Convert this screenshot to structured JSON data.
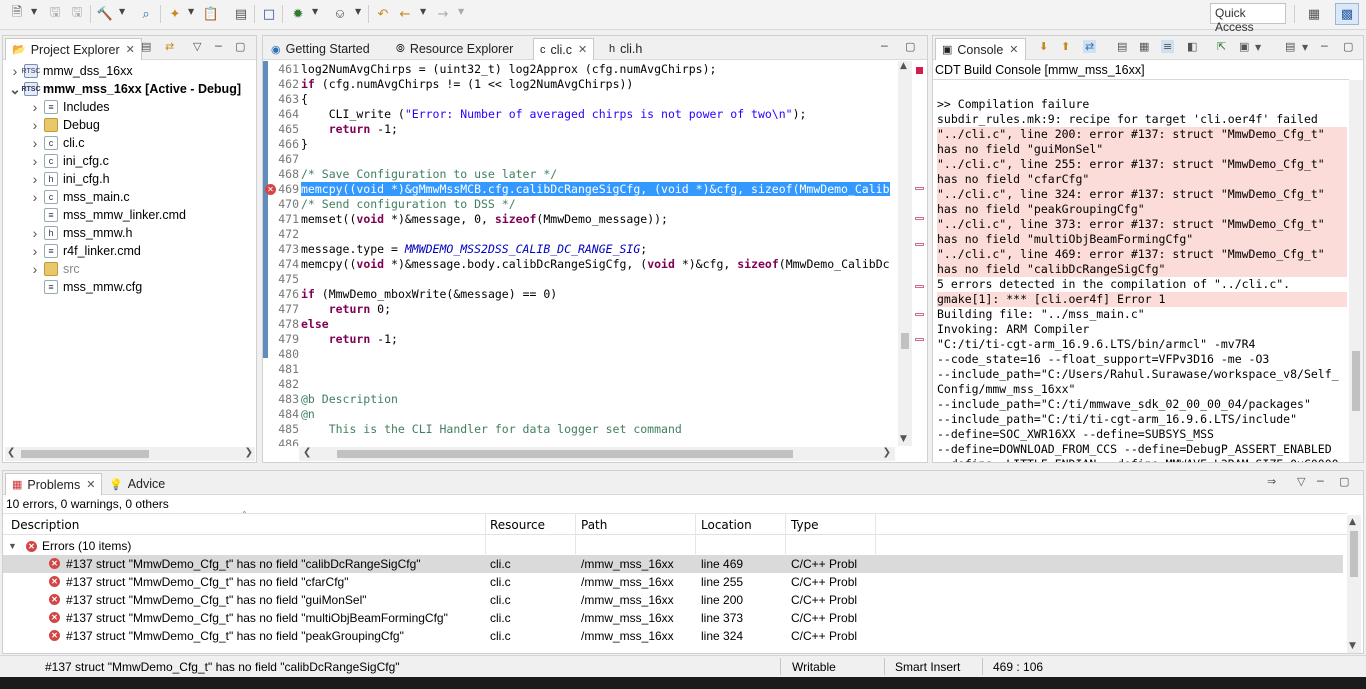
{
  "toolbar": {
    "quick_access": "Quick Access"
  },
  "project_explorer": {
    "tab_label": "Project Explorer",
    "items": [
      {
        "label": "mmw_dss_16xx",
        "icon": "project-icon"
      },
      {
        "label": "mmw_mss_16xx  [Active - Debug]",
        "icon": "project-icon"
      },
      {
        "label": "Includes",
        "icon": "includes-icon"
      },
      {
        "label": "Debug",
        "icon": "folder-icon"
      },
      {
        "label": "cli.c",
        "icon": "c-file-icon"
      },
      {
        "label": "ini_cfg.c",
        "icon": "c-file-icon"
      },
      {
        "label": "ini_cfg.h",
        "icon": "h-file-icon"
      },
      {
        "label": "mss_main.c",
        "icon": "c-file-icon"
      },
      {
        "label": "mss_mmw_linker.cmd",
        "icon": "file-icon"
      },
      {
        "label": "mss_mmw.h",
        "icon": "h-file-icon"
      },
      {
        "label": "r4f_linker.cmd",
        "icon": "file-icon"
      },
      {
        "label": "src",
        "icon": "folder-icon"
      },
      {
        "label": "mss_mmw.cfg",
        "icon": "file-icon"
      }
    ]
  },
  "editor": {
    "tabs": [
      {
        "label": "Getting Started"
      },
      {
        "label": "Resource Explorer"
      },
      {
        "label": "cli.c"
      },
      {
        "label": "cli.h"
      }
    ],
    "lines": [
      {
        "num": "461",
        "text": "log2NumAvgChirps = (uint32_t) log2Approx (cfg.numAvgChirps);"
      },
      {
        "num": "462",
        "text": "if (cfg.numAvgChirps != (1 << log2NumAvgChirps))"
      },
      {
        "num": "463",
        "text": "{"
      },
      {
        "num": "464",
        "text": "    CLI_write (\"Error: Number of averaged chirps is not power of two\\n\");"
      },
      {
        "num": "465",
        "text": "    return -1;"
      },
      {
        "num": "466",
        "text": "}"
      },
      {
        "num": "467",
        "text": ""
      },
      {
        "num": "468",
        "text": "/* Save Configuration to use later */"
      },
      {
        "num": "469",
        "text": "memcpy((void *)&gMmwMssMCB.cfg.calibDcRangeSigCfg, (void *)&cfg, sizeof(MmwDemo_Calib"
      },
      {
        "num": "470",
        "text": "/* Send configuration to DSS */"
      },
      {
        "num": "471",
        "text": "memset((void *)&message, 0, sizeof(MmwDemo_message));"
      },
      {
        "num": "472",
        "text": ""
      },
      {
        "num": "473",
        "text": "message.type = MMWDEMO_MSS2DSS_CALIB_DC_RANGE_SIG;"
      },
      {
        "num": "474",
        "text": "memcpy((void *)&message.body.calibDcRangeSigCfg, (void *)&cfg, sizeof(MmwDemo_CalibDc"
      },
      {
        "num": "475",
        "text": ""
      },
      {
        "num": "476",
        "text": "if (MmwDemo_mboxWrite(&message) == 0)"
      },
      {
        "num": "477",
        "text": "    return 0;"
      },
      {
        "num": "478",
        "text": "else"
      },
      {
        "num": "479",
        "text": "    return -1;"
      },
      {
        "num": "480",
        "text": ""
      },
      {
        "num": "481",
        "text": ""
      },
      {
        "num": "482",
        "text": ""
      },
      {
        "num": "483",
        "text": "@b Description"
      },
      {
        "num": "484",
        "text": "@n"
      },
      {
        "num": "485",
        "text": "    This is the CLI Handler for data logger set command"
      },
      {
        "num": "486",
        "text": ""
      }
    ]
  },
  "console": {
    "tab_label": "Console",
    "title": "CDT Build Console [mmw_mss_16xx]",
    "lines": [
      {
        "text": "",
        "err": false
      },
      {
        "text": ">> Compilation failure",
        "err": false
      },
      {
        "text": "subdir_rules.mk:9: recipe for target 'cli.oer4f' failed",
        "err": false
      },
      {
        "text": "\"../cli.c\", line 200: error #137: struct \"MmwDemo_Cfg_t\"",
        "err": true
      },
      {
        "text": "has no field \"guiMonSel\"",
        "err": true
      },
      {
        "text": "\"../cli.c\", line 255: error #137: struct \"MmwDemo_Cfg_t\"",
        "err": true
      },
      {
        "text": "has no field \"cfarCfg\"",
        "err": true
      },
      {
        "text": "\"../cli.c\", line 324: error #137: struct \"MmwDemo_Cfg_t\"",
        "err": true
      },
      {
        "text": "has no field \"peakGroupingCfg\"",
        "err": true
      },
      {
        "text": "\"../cli.c\", line 373: error #137: struct \"MmwDemo_Cfg_t\"",
        "err": true
      },
      {
        "text": "has no field \"multiObjBeamFormingCfg\"",
        "err": true
      },
      {
        "text": "\"../cli.c\", line 469: error #137: struct \"MmwDemo_Cfg_t\"",
        "err": true
      },
      {
        "text": "has no field \"calibDcRangeSigCfg\"",
        "err": true
      },
      {
        "text": "5 errors detected in the compilation of \"../cli.c\".",
        "err": false
      },
      {
        "text": "gmake[1]: *** [cli.oer4f] Error 1",
        "err": true
      },
      {
        "text": "Building file: \"../mss_main.c\"",
        "err": false
      },
      {
        "text": "Invoking: ARM Compiler",
        "err": false
      },
      {
        "text": "\"C:/ti/ti-cgt-arm_16.9.6.LTS/bin/armcl\" -mv7R4",
        "err": false
      },
      {
        "text": "--code_state=16 --float_support=VFPv3D16 -me -O3",
        "err": false
      },
      {
        "text": "--include_path=\"C:/Users/Rahul.Surawase/workspace_v8/Self_",
        "err": false
      },
      {
        "text": "Config/mmw_mss_16xx\"",
        "err": false
      },
      {
        "text": "--include_path=\"C:/ti/mmwave_sdk_02_00_00_04/packages\"",
        "err": false
      },
      {
        "text": "--include_path=\"C:/ti/ti-cgt-arm_16.9.6.LTS/include\"",
        "err": false
      },
      {
        "text": "--define=SOC_XWR16XX --define=SUBSYS_MSS",
        "err": false
      },
      {
        "text": "--define=DOWNLOAD_FROM_CCS --define=DebugP_ASSERT_ENABLED",
        "err": false
      },
      {
        "text": "--define=_LITTLE_ENDIAN --define=MMWAVE_L3RAM_SIZE=0xC0000",
        "err": false
      }
    ]
  },
  "problems": {
    "tabs": [
      {
        "label": "Problems"
      },
      {
        "label": "Advice"
      }
    ],
    "summary": "10 errors, 0 warnings, 0 others",
    "columns": [
      "Description",
      "Resource",
      "Path",
      "Location",
      "Type"
    ],
    "group_label": "Errors (10 items)",
    "rows": [
      {
        "description": "#137 struct \"MmwDemo_Cfg_t\" has no field \"calibDcRangeSigCfg\"",
        "resource": "cli.c",
        "path": "/mmw_mss_16xx",
        "location": "line 469",
        "type": "C/C++ Probl"
      },
      {
        "description": "#137 struct \"MmwDemo_Cfg_t\" has no field \"cfarCfg\"",
        "resource": "cli.c",
        "path": "/mmw_mss_16xx",
        "location": "line 255",
        "type": "C/C++ Probl"
      },
      {
        "description": "#137 struct \"MmwDemo_Cfg_t\" has no field \"guiMonSel\"",
        "resource": "cli.c",
        "path": "/mmw_mss_16xx",
        "location": "line 200",
        "type": "C/C++ Probl"
      },
      {
        "description": "#137 struct \"MmwDemo_Cfg_t\" has no field \"multiObjBeamFormingCfg\"",
        "resource": "cli.c",
        "path": "/mmw_mss_16xx",
        "location": "line 373",
        "type": "C/C++ Probl"
      },
      {
        "description": "#137 struct \"MmwDemo_Cfg_t\" has no field \"peakGroupingCfg\"",
        "resource": "cli.c",
        "path": "/mmw_mss_16xx",
        "location": "line 324",
        "type": "C/C++ Probl"
      }
    ]
  },
  "statusbar": {
    "message": "#137 struct \"MmwDemo_Cfg_t\" has no field \"calibDcRangeSigCfg\"",
    "writable": "Writable",
    "insert_mode": "Smart Insert",
    "position": "469 : 106"
  }
}
